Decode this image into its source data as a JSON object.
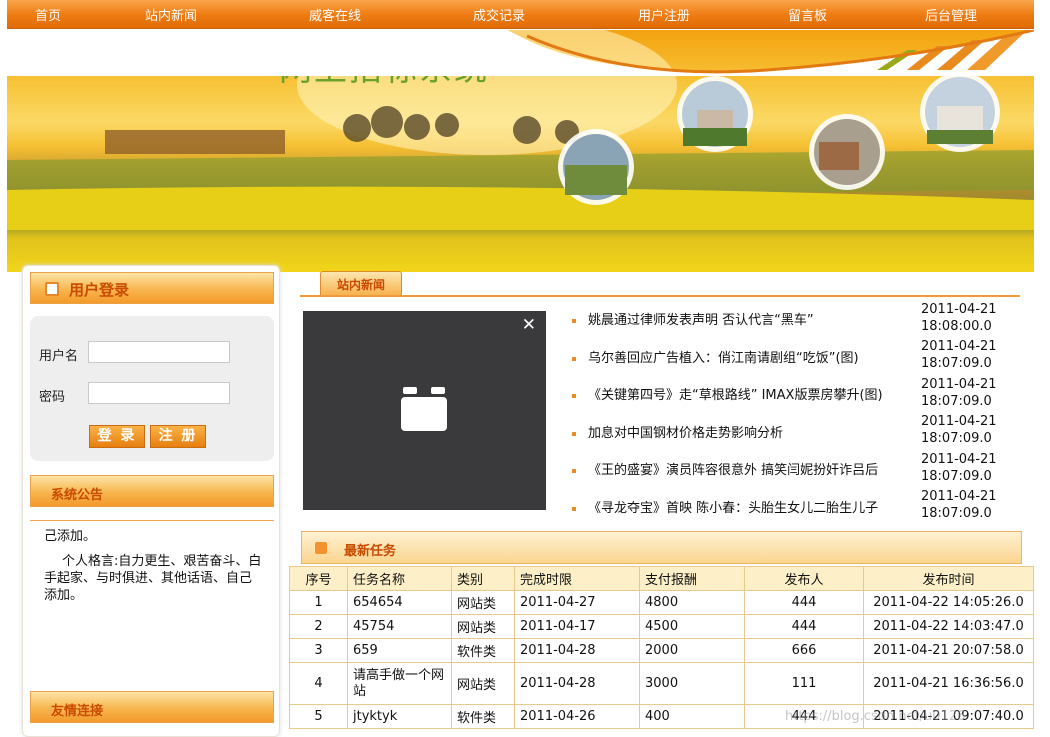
{
  "nav": [
    "首页",
    "站内新闻",
    "威客在线",
    "成交记录",
    "用户注册",
    "留言板",
    "后台管理"
  ],
  "banner": {
    "title": "网上招标系统"
  },
  "login": {
    "header": "用户登录",
    "username_label": "用户名",
    "password_label": "密码",
    "login_button": "登 录",
    "register_button": "注 册"
  },
  "notice": {
    "header": "系统公告",
    "line1": "己添加。",
    "line2": "个人格言:自力更生、艰苦奋斗、白手起家、与时俱进、其他话语、自己添加。"
  },
  "friend_links": {
    "header": "友情连接"
  },
  "news": {
    "tab": "站内新闻",
    "items": [
      {
        "title": "姚晨通过律师发表声明 否认代言“黑车”",
        "date": "2011-04-21",
        "time": "18:08:00.0"
      },
      {
        "title": "乌尔善回应广告植入：俏江南请剧组“吃饭”(图)",
        "date": "2011-04-21",
        "time": "18:07:09.0"
      },
      {
        "title": "《关键第四号》走“草根路线” IMAX版票房攀升(图)",
        "date": "2011-04-21",
        "time": "18:07:09.0"
      },
      {
        "title": "加息对中国钢材价格走势影响分析",
        "date": "2011-04-21",
        "time": "18:07:09.0"
      },
      {
        "title": "《王的盛宴》演员阵容很意外 搞笑闫妮扮奸诈吕后",
        "date": "2011-04-21",
        "time": "18:07:09.0"
      },
      {
        "title": "《寻龙夺宝》首映 陈小春：头胎生女儿二胎生儿子",
        "date": "2011-04-21",
        "time": "18:07:09.0"
      }
    ]
  },
  "tasks": {
    "header": "最新任务",
    "columns": [
      "序号",
      "任务名称",
      "类别",
      "完成时限",
      "支付报酬",
      "发布人",
      "发布时间"
    ],
    "rows": [
      [
        "1",
        "654654",
        "网站类",
        "2011-04-27",
        "4800",
        "444",
        "2011-04-22 14:05:26.0"
      ],
      [
        "2",
        "45754",
        "网站类",
        "2011-04-17",
        "4500",
        "444",
        "2011-04-22 14:03:47.0"
      ],
      [
        "3",
        "659",
        "软件类",
        "2011-04-28",
        "2000",
        "666",
        "2011-04-21 20:07:58.0"
      ],
      [
        "4",
        "请高手做一个网站",
        "网站类",
        "2011-04-28",
        "3000",
        "111",
        "2011-04-21 16:36:56.0"
      ],
      [
        "5",
        "jtyktyk",
        "软件类",
        "2011-04-26",
        "400",
        "444",
        "2011-04-21 09:07:40.0"
      ]
    ]
  },
  "watermark": "https://blog.csdn.net/u0126"
}
